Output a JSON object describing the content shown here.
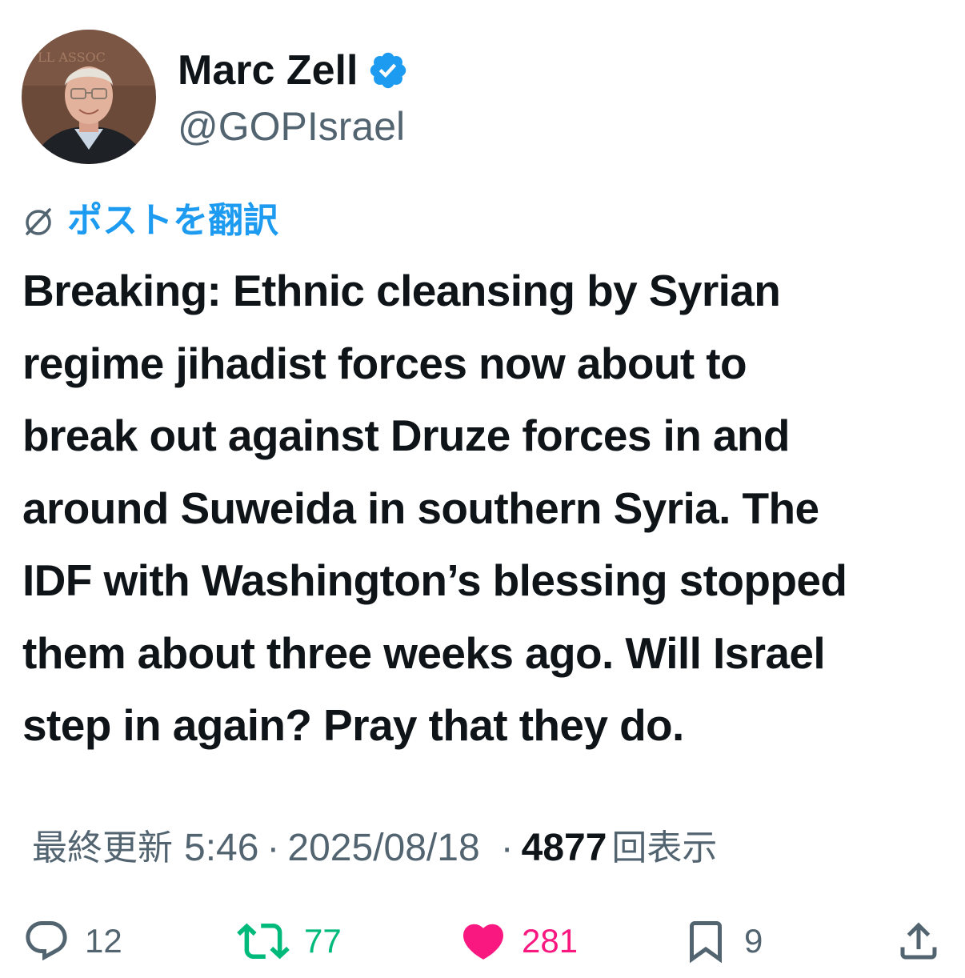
{
  "author": {
    "name": "Marc Zell",
    "handle": "@GOPIsrael",
    "verified": true,
    "avatar_alt": "Marc Zell profile photo"
  },
  "translate": {
    "label": "ポストを翻訳",
    "icon": "translate-icon"
  },
  "tweet": {
    "text": "Breaking:  Ethnic cleansing by Syrian\nregime jihadist forces now about to\nbreak out against Druze forces in and\naround Suweida in southern Syria.  The\nIDF with Washington’s blessing stopped\nthem about three weeks ago.  Will Israel\nstep in again?  Pray that they do."
  },
  "meta": {
    "updated_label": "最終更新",
    "time": "5:46",
    "separator": "·",
    "date": "2025/08/18",
    "views_count": "4877",
    "views_label": "回表示"
  },
  "actions": {
    "reply": {
      "icon": "reply-icon",
      "count": "12"
    },
    "retweet": {
      "icon": "retweet-icon",
      "count": "77"
    },
    "like": {
      "icon": "heart-icon",
      "count": "281"
    },
    "bookmark": {
      "icon": "bookmark-icon",
      "count": "9"
    },
    "share": {
      "icon": "share-icon"
    }
  },
  "colors": {
    "accent_blue": "#1d9bf0",
    "text_primary": "#0f1419",
    "text_secondary": "#536471",
    "retweet_green": "#00ba7c",
    "like_pink": "#f91880"
  }
}
